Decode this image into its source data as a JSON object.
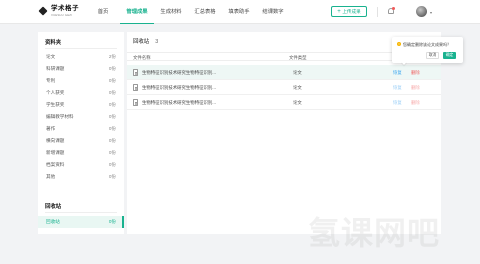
{
  "header": {
    "logo_title": "学术格子",
    "logo_sub": "XUESHU GEZI",
    "nav": [
      "首页",
      "管理成果",
      "生成材料",
      "汇总表格",
      "填表助手",
      "结课数字"
    ],
    "active_nav": 1,
    "upload_label": "上传成果",
    "upload_icon": "plus-icon"
  },
  "sidebar": {
    "section1_title": "资料夹",
    "items": [
      {
        "label": "论文",
        "count": "2份"
      },
      {
        "label": "科研课题",
        "count": "0份"
      },
      {
        "label": "专利",
        "count": "0份"
      },
      {
        "label": "个人获奖",
        "count": "0份"
      },
      {
        "label": "学生获奖",
        "count": "0份"
      },
      {
        "label": "编辑教学材料",
        "count": "0份"
      },
      {
        "label": "著作",
        "count": "0份"
      },
      {
        "label": "横向课题",
        "count": "0份"
      },
      {
        "label": "新增课题",
        "count": "0份"
      },
      {
        "label": "档案资料",
        "count": "0份"
      },
      {
        "label": "其他",
        "count": "0份"
      }
    ],
    "section2_title": "回收站",
    "recycle": {
      "label": "回收站",
      "count": "0份"
    }
  },
  "main": {
    "title": "回收站",
    "count": "3",
    "columns": {
      "name": "文件名称",
      "type": "文件类型"
    },
    "rows": [
      {
        "name": "生物特征识别技术研究生物特征识别...",
        "type": "论文",
        "restore": "恢复",
        "delete": "删除"
      },
      {
        "name": "生物特征识别技术研究生物特征识别...",
        "type": "论文",
        "restore": "恢复",
        "delete": "删除"
      },
      {
        "name": "生物特征识别技术研究生物特征识别...",
        "type": "论文",
        "restore": "恢复",
        "delete": "删除"
      }
    ]
  },
  "popover": {
    "message": "您确定删除该论文成果吗？",
    "cancel": "取消",
    "confirm": "确定"
  },
  "watermark": "氢课网吧",
  "colors": {
    "accent": "#19b28f",
    "danger": "#f05a5a",
    "link": "#3aa6f0",
    "warning": "#f7b500"
  }
}
